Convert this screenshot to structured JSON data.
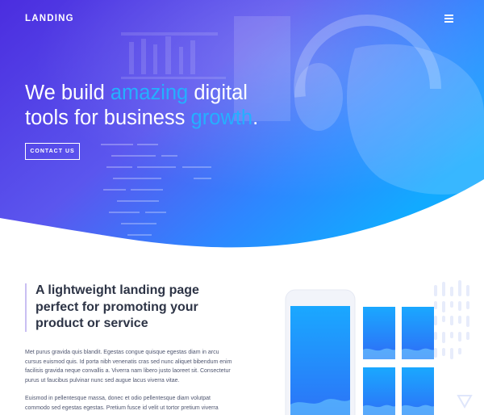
{
  "navbar": {
    "logo": "LANDING",
    "menu_icon": "hamburger-menu-icon"
  },
  "hero": {
    "title_part1": "We build ",
    "title_highlight1": "amazing",
    "title_part2": " digital tools for business ",
    "title_highlight2": "growth",
    "title_end": ".",
    "cta_label": "CONTACT US"
  },
  "feature": {
    "title": "A lightweight landing page perfect for promoting your product or service",
    "paragraph1": "Met purus gravida quis blandit. Egestas congue quisque egestas diam in arcu cursus euismod quis. Id porta nibh venenatis cras sed nunc aliquet bibendum enim facilisis gravida neque convallis a. Viverra nam libero justo laoreet sit. Consectetur purus ut faucibus pulvinar nunc sed augue lacus viverra vitae.",
    "paragraph2": "Euismod in pellentesque massa, donec et odio pellentesque diam volutpat commodo sed egestas egestas. Pretium fusce id velit ut tortor pretium viverra"
  },
  "colors": {
    "hero_gradient_start": "#4a2fe0",
    "hero_gradient_mid": "#5d4cf0",
    "hero_gradient_end": "#12a7ff",
    "highlight": "#24b0ff",
    "title_text": "#2d3446",
    "body_text": "#4f5670",
    "quote_bar": "#c9bff2"
  }
}
